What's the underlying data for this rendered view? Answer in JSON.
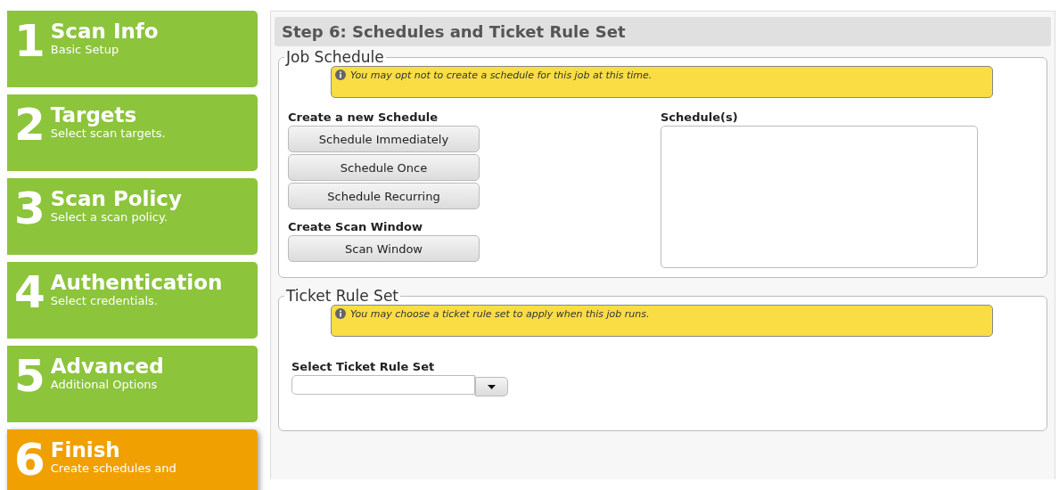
{
  "steps": [
    {
      "number": "1",
      "title": "Scan Info",
      "subtitle": "Basic Setup",
      "selected": false
    },
    {
      "number": "2",
      "title": "Targets",
      "subtitle": "Select scan targets.",
      "selected": false
    },
    {
      "number": "3",
      "title": "Scan Policy",
      "subtitle": "Select a scan policy.",
      "selected": false
    },
    {
      "number": "4",
      "title": "Authentication",
      "subtitle": "Select credentials.",
      "selected": false
    },
    {
      "number": "5",
      "title": "Advanced",
      "subtitle": "Additional Options",
      "selected": false
    },
    {
      "number": "6",
      "title": "Finish",
      "subtitle": "Create schedules and",
      "selected": true
    }
  ],
  "panel": {
    "title": "Step 6: Schedules and Ticket Rule Set",
    "job_schedule": {
      "legend": "Job Schedule",
      "info": "You may opt not to create a schedule for this job at this time.",
      "new_schedule_label": "Create a new Schedule",
      "schedule_buttons": [
        "Schedule Immediately",
        "Schedule Once",
        "Schedule Recurring"
      ],
      "scan_window_label": "Create Scan Window",
      "scan_window_button": "Scan Window",
      "schedules_label": "Schedule(s)"
    },
    "ticket_rule_set": {
      "legend": "Ticket Rule Set",
      "info": "You may choose a ticket rule set to apply when this job runs.",
      "select_label": "Select Ticket Rule Set"
    }
  }
}
